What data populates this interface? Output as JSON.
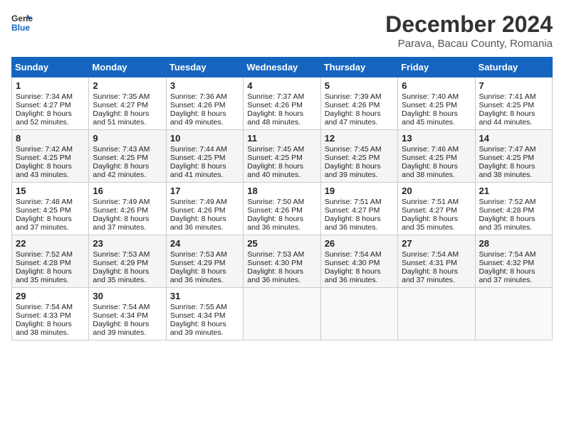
{
  "header": {
    "logo_general": "General",
    "logo_blue": "Blue",
    "title": "December 2024",
    "subtitle": "Parava, Bacau County, Romania"
  },
  "days_of_week": [
    "Sunday",
    "Monday",
    "Tuesday",
    "Wednesday",
    "Thursday",
    "Friday",
    "Saturday"
  ],
  "weeks": [
    [
      {
        "day": 1,
        "lines": [
          "Sunrise: 7:34 AM",
          "Sunset: 4:27 PM",
          "Daylight: 8 hours",
          "and 52 minutes."
        ]
      },
      {
        "day": 2,
        "lines": [
          "Sunrise: 7:35 AM",
          "Sunset: 4:27 PM",
          "Daylight: 8 hours",
          "and 51 minutes."
        ]
      },
      {
        "day": 3,
        "lines": [
          "Sunrise: 7:36 AM",
          "Sunset: 4:26 PM",
          "Daylight: 8 hours",
          "and 49 minutes."
        ]
      },
      {
        "day": 4,
        "lines": [
          "Sunrise: 7:37 AM",
          "Sunset: 4:26 PM",
          "Daylight: 8 hours",
          "and 48 minutes."
        ]
      },
      {
        "day": 5,
        "lines": [
          "Sunrise: 7:39 AM",
          "Sunset: 4:26 PM",
          "Daylight: 8 hours",
          "and 47 minutes."
        ]
      },
      {
        "day": 6,
        "lines": [
          "Sunrise: 7:40 AM",
          "Sunset: 4:25 PM",
          "Daylight: 8 hours",
          "and 45 minutes."
        ]
      },
      {
        "day": 7,
        "lines": [
          "Sunrise: 7:41 AM",
          "Sunset: 4:25 PM",
          "Daylight: 8 hours",
          "and 44 minutes."
        ]
      }
    ],
    [
      {
        "day": 8,
        "lines": [
          "Sunrise: 7:42 AM",
          "Sunset: 4:25 PM",
          "Daylight: 8 hours",
          "and 43 minutes."
        ]
      },
      {
        "day": 9,
        "lines": [
          "Sunrise: 7:43 AM",
          "Sunset: 4:25 PM",
          "Daylight: 8 hours",
          "and 42 minutes."
        ]
      },
      {
        "day": 10,
        "lines": [
          "Sunrise: 7:44 AM",
          "Sunset: 4:25 PM",
          "Daylight: 8 hours",
          "and 41 minutes."
        ]
      },
      {
        "day": 11,
        "lines": [
          "Sunrise: 7:45 AM",
          "Sunset: 4:25 PM",
          "Daylight: 8 hours",
          "and 40 minutes."
        ]
      },
      {
        "day": 12,
        "lines": [
          "Sunrise: 7:45 AM",
          "Sunset: 4:25 PM",
          "Daylight: 8 hours",
          "and 39 minutes."
        ]
      },
      {
        "day": 13,
        "lines": [
          "Sunrise: 7:46 AM",
          "Sunset: 4:25 PM",
          "Daylight: 8 hours",
          "and 38 minutes."
        ]
      },
      {
        "day": 14,
        "lines": [
          "Sunrise: 7:47 AM",
          "Sunset: 4:25 PM",
          "Daylight: 8 hours",
          "and 38 minutes."
        ]
      }
    ],
    [
      {
        "day": 15,
        "lines": [
          "Sunrise: 7:48 AM",
          "Sunset: 4:25 PM",
          "Daylight: 8 hours",
          "and 37 minutes."
        ]
      },
      {
        "day": 16,
        "lines": [
          "Sunrise: 7:49 AM",
          "Sunset: 4:26 PM",
          "Daylight: 8 hours",
          "and 37 minutes."
        ]
      },
      {
        "day": 17,
        "lines": [
          "Sunrise: 7:49 AM",
          "Sunset: 4:26 PM",
          "Daylight: 8 hours",
          "and 36 minutes."
        ]
      },
      {
        "day": 18,
        "lines": [
          "Sunrise: 7:50 AM",
          "Sunset: 4:26 PM",
          "Daylight: 8 hours",
          "and 36 minutes."
        ]
      },
      {
        "day": 19,
        "lines": [
          "Sunrise: 7:51 AM",
          "Sunset: 4:27 PM",
          "Daylight: 8 hours",
          "and 36 minutes."
        ]
      },
      {
        "day": 20,
        "lines": [
          "Sunrise: 7:51 AM",
          "Sunset: 4:27 PM",
          "Daylight: 8 hours",
          "and 35 minutes."
        ]
      },
      {
        "day": 21,
        "lines": [
          "Sunrise: 7:52 AM",
          "Sunset: 4:28 PM",
          "Daylight: 8 hours",
          "and 35 minutes."
        ]
      }
    ],
    [
      {
        "day": 22,
        "lines": [
          "Sunrise: 7:52 AM",
          "Sunset: 4:28 PM",
          "Daylight: 8 hours",
          "and 35 minutes."
        ]
      },
      {
        "day": 23,
        "lines": [
          "Sunrise: 7:53 AM",
          "Sunset: 4:29 PM",
          "Daylight: 8 hours",
          "and 35 minutes."
        ]
      },
      {
        "day": 24,
        "lines": [
          "Sunrise: 7:53 AM",
          "Sunset: 4:29 PM",
          "Daylight: 8 hours",
          "and 36 minutes."
        ]
      },
      {
        "day": 25,
        "lines": [
          "Sunrise: 7:53 AM",
          "Sunset: 4:30 PM",
          "Daylight: 8 hours",
          "and 36 minutes."
        ]
      },
      {
        "day": 26,
        "lines": [
          "Sunrise: 7:54 AM",
          "Sunset: 4:30 PM",
          "Daylight: 8 hours",
          "and 36 minutes."
        ]
      },
      {
        "day": 27,
        "lines": [
          "Sunrise: 7:54 AM",
          "Sunset: 4:31 PM",
          "Daylight: 8 hours",
          "and 37 minutes."
        ]
      },
      {
        "day": 28,
        "lines": [
          "Sunrise: 7:54 AM",
          "Sunset: 4:32 PM",
          "Daylight: 8 hours",
          "and 37 minutes."
        ]
      }
    ],
    [
      {
        "day": 29,
        "lines": [
          "Sunrise: 7:54 AM",
          "Sunset: 4:33 PM",
          "Daylight: 8 hours",
          "and 38 minutes."
        ]
      },
      {
        "day": 30,
        "lines": [
          "Sunrise: 7:54 AM",
          "Sunset: 4:34 PM",
          "Daylight: 8 hours",
          "and 39 minutes."
        ]
      },
      {
        "day": 31,
        "lines": [
          "Sunrise: 7:55 AM",
          "Sunset: 4:34 PM",
          "Daylight: 8 hours",
          "and 39 minutes."
        ]
      },
      null,
      null,
      null,
      null
    ]
  ]
}
